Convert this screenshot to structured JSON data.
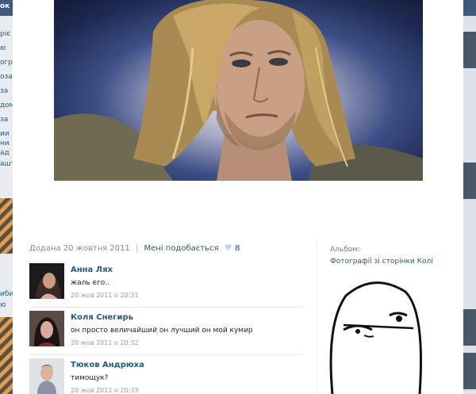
{
  "photo": {
    "alt": "portrait"
  },
  "meta": {
    "added": "Додана 20 жовтня 2011",
    "like_label": "Мені подобається",
    "like_count": "8"
  },
  "comments": [
    {
      "author": "Анна Лях",
      "text": "жаль его..",
      "date": "20 жов 2011 о 20:31"
    },
    {
      "author": "Коля Снегирь",
      "text": "он просто величайший он лучший он мой кумир",
      "date": "20 жов 2011 о 20:32"
    },
    {
      "author": "Тюков Андрюха",
      "text": "тимощук?",
      "date": "20 жов 2011 о 20:33"
    }
  ],
  "album": {
    "label": "Альбом:",
    "title": "Фотографії зі сторінки Колі"
  },
  "background_fragments": [
    "ок",
    "ріє",
    "ю",
    "огр",
    "оза",
    "за",
    "дом",
    "за",
    "ии",
    "ни",
    "ад",
    "ашт",
    "иби",
    "ю",
    "ьн"
  ],
  "colors": {
    "link": "#2b587a",
    "overlay": "#5b6f86",
    "panel": "#ffffff"
  }
}
